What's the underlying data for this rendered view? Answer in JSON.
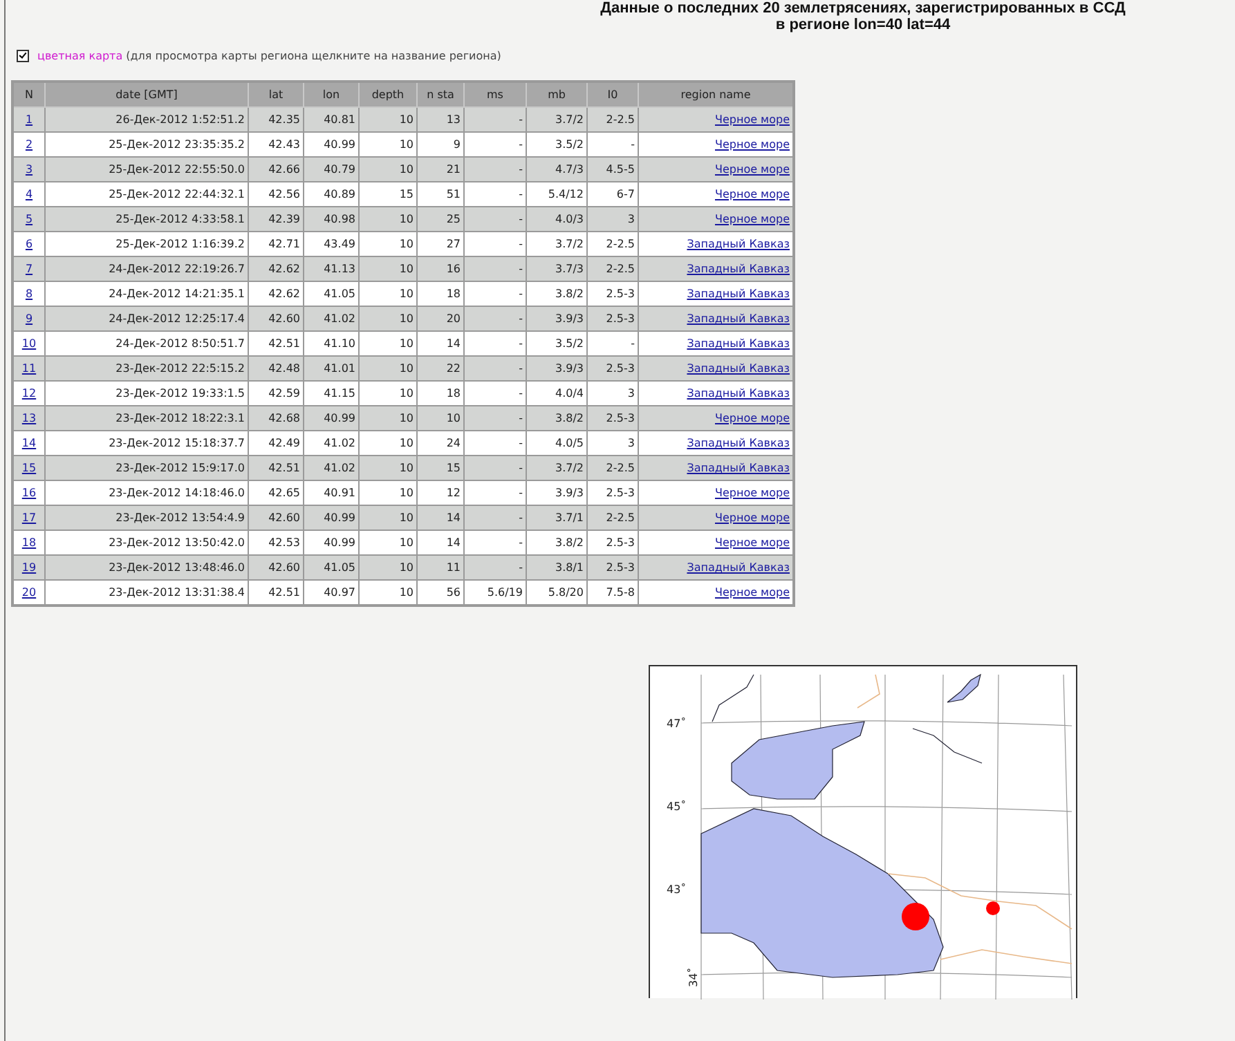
{
  "header": {
    "title_line_1": "Данные о последних 20 землетрясениях, зарегистрированных в ССД",
    "title_line_2": "в регионе lon=40 lat=44"
  },
  "map_option": {
    "checked": true,
    "link": "цветная карта",
    "hint": " (для просмотра карты региона щелкните на название региона)"
  },
  "table": {
    "columns": [
      "N",
      "date [GMT]",
      "lat",
      "lon",
      "depth",
      "n sta",
      "ms",
      "mb",
      "I0",
      "region name"
    ],
    "rows": [
      [
        "1",
        "26-Дек-2012 1:52:51.2",
        "42.35",
        "40.81",
        "10",
        "13",
        "-",
        "3.7/2",
        "2-2.5",
        "Черное море"
      ],
      [
        "2",
        "25-Дек-2012 23:35:35.2",
        "42.43",
        "40.99",
        "10",
        "9",
        "-",
        "3.5/2",
        "-",
        "Черное море"
      ],
      [
        "3",
        "25-Дек-2012 22:55:50.0",
        "42.66",
        "40.79",
        "10",
        "21",
        "-",
        "4.7/3",
        "4.5-5",
        "Черное море"
      ],
      [
        "4",
        "25-Дек-2012 22:44:32.1",
        "42.56",
        "40.89",
        "15",
        "51",
        "-",
        "5.4/12",
        "6-7",
        "Черное море"
      ],
      [
        "5",
        "25-Дек-2012 4:33:58.1",
        "42.39",
        "40.98",
        "10",
        "25",
        "-",
        "4.0/3",
        "3",
        "Черное море"
      ],
      [
        "6",
        "25-Дек-2012 1:16:39.2",
        "42.71",
        "43.49",
        "10",
        "27",
        "-",
        "3.7/2",
        "2-2.5",
        "Западный Кавказ"
      ],
      [
        "7",
        "24-Дек-2012 22:19:26.7",
        "42.62",
        "41.13",
        "10",
        "16",
        "-",
        "3.7/3",
        "2-2.5",
        "Западный Кавказ"
      ],
      [
        "8",
        "24-Дек-2012 14:21:35.1",
        "42.62",
        "41.05",
        "10",
        "18",
        "-",
        "3.8/2",
        "2.5-3",
        "Западный Кавказ"
      ],
      [
        "9",
        "24-Дек-2012 12:25:17.4",
        "42.60",
        "41.02",
        "10",
        "20",
        "-",
        "3.9/3",
        "2.5-3",
        "Западный Кавказ"
      ],
      [
        "10",
        "24-Дек-2012 8:50:51.7",
        "42.51",
        "41.10",
        "10",
        "14",
        "-",
        "3.5/2",
        "-",
        "Западный Кавказ"
      ],
      [
        "11",
        "23-Дек-2012 22:5:15.2",
        "42.48",
        "41.01",
        "10",
        "22",
        "-",
        "3.9/3",
        "2.5-3",
        "Западный Кавказ"
      ],
      [
        "12",
        "23-Дек-2012 19:33:1.5",
        "42.59",
        "41.15",
        "10",
        "18",
        "-",
        "4.0/4",
        "3",
        "Западный Кавказ"
      ],
      [
        "13",
        "23-Дек-2012 18:22:3.1",
        "42.68",
        "40.99",
        "10",
        "10",
        "-",
        "3.8/2",
        "2.5-3",
        "Черное море"
      ],
      [
        "14",
        "23-Дек-2012 15:18:37.7",
        "42.49",
        "41.02",
        "10",
        "24",
        "-",
        "4.0/5",
        "3",
        "Западный Кавказ"
      ],
      [
        "15",
        "23-Дек-2012 15:9:17.0",
        "42.51",
        "41.02",
        "10",
        "15",
        "-",
        "3.7/2",
        "2-2.5",
        "Западный Кавказ"
      ],
      [
        "16",
        "23-Дек-2012 14:18:46.0",
        "42.65",
        "40.91",
        "10",
        "12",
        "-",
        "3.9/3",
        "2.5-3",
        "Черное море"
      ],
      [
        "17",
        "23-Дек-2012 13:54:4.9",
        "42.60",
        "40.99",
        "10",
        "14",
        "-",
        "3.7/1",
        "2-2.5",
        "Черное море"
      ],
      [
        "18",
        "23-Дек-2012 13:50:42.0",
        "42.53",
        "40.99",
        "10",
        "14",
        "-",
        "3.8/2",
        "2.5-3",
        "Черное море"
      ],
      [
        "19",
        "23-Дек-2012 13:48:46.0",
        "42.60",
        "41.05",
        "10",
        "11",
        "-",
        "3.8/1",
        "2.5-3",
        "Западный Кавказ"
      ],
      [
        "20",
        "23-Дек-2012 13:31:38.4",
        "42.51",
        "40.97",
        "10",
        "56",
        "5.6/19",
        "5.8/20",
        "7.5-8",
        "Черное море"
      ]
    ]
  },
  "map": {
    "lat_labels": [
      "47˚",
      "45˚",
      "43˚"
    ],
    "lon_label": "34˚"
  }
}
